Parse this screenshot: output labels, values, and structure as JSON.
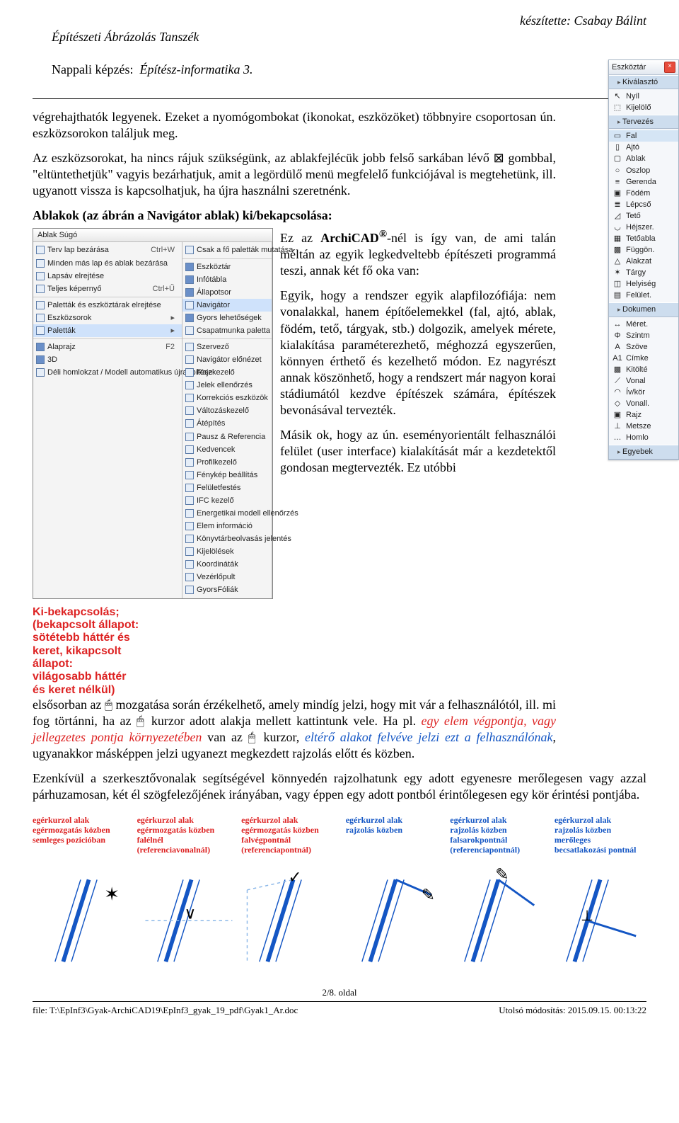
{
  "header": {
    "dept": "Építészeti Ábrázolás Tanszék",
    "author": "készítette: Csabay Bálint",
    "course_label": "Nappali képzés:",
    "course_name": "Építész-informatika 3."
  },
  "body": {
    "p1": "végrehajthatók legyenek. Ezeket a nyomógombokat (ikonokat, eszközöket) többnyire csoportosan ún. eszközsorokon találjuk meg.",
    "p2": "Az eszközsorokat, ha nincs rájuk szükségünk, az ablakfejlécük jobb felső sarkában lévő ⊠ gombbal, \"eltüntethetjük\" vagyis bezárhatjuk, amit a legördülő menü megfelelő funkciójával is megtehetünk, ill. ugyanott vissza is kapcsolhatjuk, ha újra használni szeretnénk.",
    "sub": "Ablakok (az ábrán a Navigátor ablak) ki/bekapcsolása:",
    "r1_a": "Ez az ",
    "r1_b": "ArchiCAD",
    "r1_sup": "®",
    "r1_c": "-nél is így van, de ami talán méltán az egyik legkedveltebb építészeti programmá teszi, annak két fő oka van:",
    "r2": "Egyik, hogy a rendszer egyik alapfilozófiája: nem vonalakkal, hanem építőelemekkel (fal, ajtó, ablak, födém, tető, tárgyak, stb.) dolgozik, amelyek mérete, kialakítása paraméterezhető, méghozzá egyszerűen, könnyen érthető és kezelhető módon. Ez nagyrészt annak köszönhető, hogy a rendszert már nagyon korai stádiumától kezdve építészek számára, építészek bevonásával tervezték.",
    "r3": "Másik ok, hogy az ún. eseményorientált felhasználói felület (user interface) kialakítását már a kezdetektől gondosan megtervezték. Ez utóbbi",
    "p3": "elsősorban az 🖱 mozgatása során érzékelhető, amely mindíg jelzi, hogy mit vár a felhasználótól, ill. mi fog törtánni, ha az 🖱 kurzor adott alakja mellett kattintunk vele. Ha pl. ",
    "p3_red": "egy elem végpontja, vagy jellegzetes pontja környezetében",
    "p3_mid": " van az 🖱 kurzor, ",
    "p3_blue": "eltérő alakot felvéve jelzi ezt a felhasználónak",
    "p3_end": ", ugyanakkor másképpen jelzi ugyanezt megkezdett rajzolás előtt és közben.",
    "p4": "Ezenkívül a szerkesztővonalak segítségével könnyedén rajzolhatunk egy adott egyenesre merőlegesen vagy azzal párhuzamosan, két él szögfelezőjének irányában, vagy éppen egy adott pontból érintőlegesen egy kör érintési pontjába."
  },
  "annotation": {
    "title": "Ki-bekapcsolás;",
    "l1": "(bekapcsolt állapot:",
    "l2": "sötétebb háttér és",
    "l3": "keret, kikapcsolt",
    "l4": "állapot:",
    "l5": "világosabb háttér",
    "l6": "és keret nélkül)"
  },
  "menu1": {
    "bar": "Ablak  Súgó",
    "items": [
      {
        "label": "Terv lap bezárása",
        "sc": "Ctrl+W"
      },
      {
        "label": "Minden más lap és ablak bezárása"
      },
      {
        "label": "Lapsáv elrejtése"
      },
      {
        "label": "Teljes képernyő",
        "sc": "Ctrl+Ű"
      },
      {
        "sep": true
      },
      {
        "label": "Paletták és eszköztárak elrejtése"
      },
      {
        "label": "Eszközsorok",
        "sub": true
      },
      {
        "label": "Paletták",
        "sub": true,
        "hi": true
      },
      {
        "sep": true
      },
      {
        "label": "Alaprajz",
        "sc": "F2",
        "on": true
      },
      {
        "label": "3D",
        "on": true
      },
      {
        "label": "Déli homlokzat / Modell automatikus újraépítése"
      }
    ]
  },
  "menu2": {
    "items": [
      {
        "label": "Csak a fő paletták mutatása"
      },
      {
        "sep": true
      },
      {
        "label": "Eszköztár",
        "on": true
      },
      {
        "label": "Infótábla",
        "on": true
      },
      {
        "label": "Állapotsor",
        "on": true
      },
      {
        "label": "Navigátor",
        "hi": true
      },
      {
        "label": "Gyors lehetőségek",
        "on": true
      },
      {
        "label": "Csapatmunka paletta"
      },
      {
        "sep": true
      },
      {
        "label": "Szervező"
      },
      {
        "label": "Navigátor előnézet"
      },
      {
        "label": "Rajzkezelő"
      },
      {
        "label": "Jelek ellenőrzés"
      },
      {
        "label": "Korrekciós eszközök"
      },
      {
        "label": "Változáskezelő"
      },
      {
        "label": "Átépítés"
      },
      {
        "label": "Pausz & Referencia"
      },
      {
        "label": "Kedvencek"
      },
      {
        "label": "Profilkezelő"
      },
      {
        "label": "Fénykép beállítás"
      },
      {
        "label": "Felületfestés"
      },
      {
        "label": "IFC kezelő"
      },
      {
        "label": "Energetikai modell ellenőrzés"
      },
      {
        "label": "Elem információ"
      },
      {
        "label": "Könyvtárbeolvasás jelentés"
      },
      {
        "label": "Kijelölések"
      },
      {
        "label": "Koordináták"
      },
      {
        "label": "Vezérlőpult"
      },
      {
        "label": "GyorsFóliák"
      }
    ]
  },
  "toolbox": {
    "title": "Eszköztár",
    "sections": [
      {
        "header": "Kiválasztó",
        "items": [
          {
            "name": "Nyíl",
            "ico": "↖"
          },
          {
            "name": "Kijelölő",
            "ico": "⬚"
          }
        ]
      },
      {
        "header": "Tervezés",
        "items": [
          {
            "name": "Fal",
            "ico": "▭",
            "hi": true
          },
          {
            "name": "Ajtó",
            "ico": "▯"
          },
          {
            "name": "Ablak",
            "ico": "▢"
          },
          {
            "name": "Oszlop",
            "ico": "○"
          },
          {
            "name": "Gerenda",
            "ico": "≡"
          },
          {
            "name": "Födém",
            "ico": "▣"
          },
          {
            "name": "Lépcső",
            "ico": "≣"
          },
          {
            "name": "Tető",
            "ico": "◿"
          },
          {
            "name": "Héjszer.",
            "ico": "◡"
          },
          {
            "name": "Tetőabla",
            "ico": "▦"
          },
          {
            "name": "Függön.",
            "ico": "▩"
          },
          {
            "name": "Alakzat",
            "ico": "△"
          },
          {
            "name": "Tárgy",
            "ico": "✶"
          },
          {
            "name": "Helyiség",
            "ico": "◫"
          },
          {
            "name": "Felület.",
            "ico": "▤"
          }
        ]
      },
      {
        "header": "Dokumen",
        "items": [
          {
            "name": "Méret.",
            "ico": "↔"
          },
          {
            "name": "Szintm",
            "ico": "Φ"
          },
          {
            "name": "Szöve",
            "ico": "A"
          },
          {
            "name": "Címke",
            "ico": "A1"
          },
          {
            "name": "Kitölté",
            "ico": "▩"
          },
          {
            "name": "Vonal",
            "ico": "⟋"
          },
          {
            "name": "Ív/kör",
            "ico": "◠"
          },
          {
            "name": "Vonall.",
            "ico": "◇"
          },
          {
            "name": "Rajz",
            "ico": "▣"
          },
          {
            "name": "Metsze",
            "ico": "⊥"
          },
          {
            "name": "Homlo",
            "ico": "…"
          }
        ]
      },
      {
        "header": "Egyebek",
        "items": []
      }
    ]
  },
  "cursors": [
    {
      "l1": "egérkurzol alak",
      "l2": "egérmozgatás közben",
      "l3": "semleges pozicióban",
      "cls": "r"
    },
    {
      "l1": "egérkurzol alak",
      "l2": "egérmozgatás közben",
      "l3": "falélnél",
      "l4": "(referenciavonalnál)",
      "cls": "r"
    },
    {
      "l1": "egérkurzol alak",
      "l2": "egérmozgatás közben",
      "l3": "falvégpontnál",
      "l4": "(referenciapontnál)",
      "cls": "r"
    },
    {
      "l1": "egérkurzol alak",
      "l2": "rajzolás közben",
      "cls": "b"
    },
    {
      "l1": "egérkurzol alak",
      "l2": "rajzolás közben",
      "l3": "falsarokpontnál",
      "l4": "(referenciapontnál)",
      "cls": "b"
    },
    {
      "l1": "egérkurzol alak",
      "l2": "rajzolás közben",
      "l3": "merőleges",
      "l4": "becsatlakozási pontnál",
      "cls": "b"
    }
  ],
  "footer": {
    "page": "2/8. oldal",
    "file": "file: T:\\EpInf3\\Gyak-ArchiCAD19\\EpInf3_gyak_19_pdf\\Gyak1_Ar.doc",
    "mod": "Utolsó módosítás: 2015.09.15.  00:13:22"
  }
}
